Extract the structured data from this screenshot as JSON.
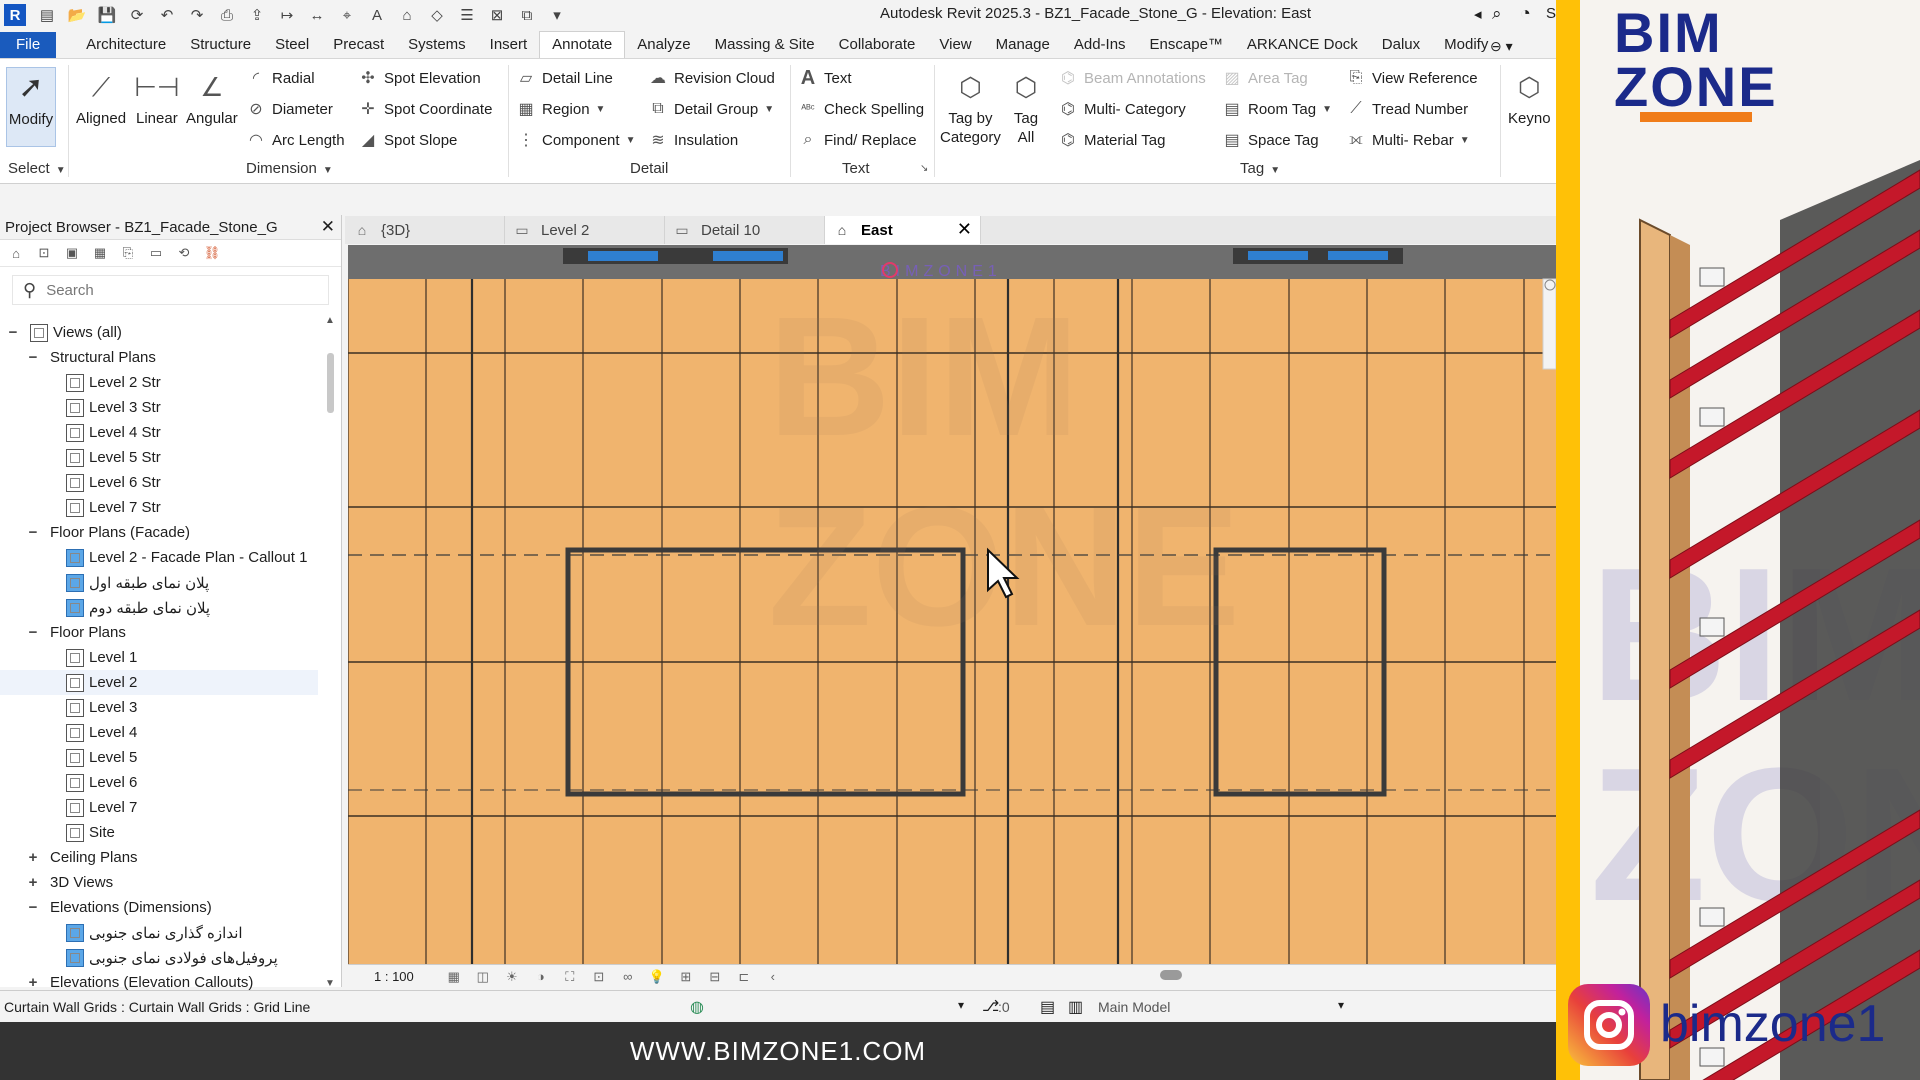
{
  "app": {
    "title": "Autodesk Revit 2025.3 - BZ1_Facade_Stone_G - Elevation: East",
    "logo_letter": "R",
    "user_initial": "S"
  },
  "menu": [
    "File",
    "Architecture",
    "Structure",
    "Steel",
    "Precast",
    "Systems",
    "Insert",
    "Annotate",
    "Analyze",
    "Massing & Site",
    "Collaborate",
    "View",
    "Manage",
    "Add-Ins",
    "Enscape™",
    "ARKANCE Dock",
    "Dalux",
    "Modify"
  ],
  "ribbon": {
    "select": {
      "modify": "Modify",
      "panel": "Select"
    },
    "dimension": {
      "aligned": "Aligned",
      "linear": "Linear",
      "angular": "Angular",
      "radial": "Radial",
      "diameter": "Diameter",
      "arc_length": "Arc  Length",
      "spot_elevation": "Spot  Elevation",
      "spot_coordinate": "Spot  Coordinate",
      "spot_slope": "Spot  Slope",
      "panel": "Dimension"
    },
    "detail": {
      "detail_line": "Detail  Line",
      "region": "Region",
      "component": "Component",
      "revision_cloud": "Revision  Cloud",
      "detail_group": "Detail  Group",
      "insulation": "Insulation",
      "panel": "Detail"
    },
    "text": {
      "text": "Text",
      "check_spelling": "Check  Spelling",
      "find_replace": "Find/  Replace",
      "panel": "Text"
    },
    "tag": {
      "tag_by_category_1": "Tag by",
      "tag_by_category_2": "Category",
      "tag_all_1": "Tag",
      "tag_all_2": "All",
      "beam_annotations": "Beam  Annotations",
      "multi_category": "Multi-  Category",
      "material_tag": "Material  Tag",
      "area_tag": "Area  Tag",
      "room_tag": "Room  Tag",
      "space_tag": "Space  Tag",
      "view_reference": "View  Reference",
      "tread_number": "Tread  Number",
      "multi_rebar": "Multi-  Rebar",
      "keynote": "Keyno",
      "panel": "Tag"
    }
  },
  "project_browser": {
    "title": "Project Browser - BZ1_Facade_Stone_G",
    "search_placeholder": "Search",
    "rows": [
      {
        "label": "Views (all)",
        "level": 0,
        "toggle": "−",
        "icon": "views"
      },
      {
        "label": "Structural Plans",
        "level": 1,
        "toggle": "−"
      },
      {
        "label": "Level 2 Str",
        "level": 2,
        "icon": "plan"
      },
      {
        "label": "Level 3 Str",
        "level": 2,
        "icon": "plan"
      },
      {
        "label": "Level 4 Str",
        "level": 2,
        "icon": "plan"
      },
      {
        "label": "Level 5 Str",
        "level": 2,
        "icon": "plan"
      },
      {
        "label": "Level 6 Str",
        "level": 2,
        "icon": "plan"
      },
      {
        "label": "Level 7 Str",
        "level": 2,
        "icon": "plan"
      },
      {
        "label": "Floor Plans (Facade)",
        "level": 1,
        "toggle": "−"
      },
      {
        "label": "Level 2 - Facade Plan - Callout 1",
        "level": 2,
        "icon": "blue"
      },
      {
        "label": "پلان نمای طبقه اول",
        "level": 2,
        "icon": "blue"
      },
      {
        "label": "پلان نمای طبقه دوم",
        "level": 2,
        "icon": "blue"
      },
      {
        "label": "Floor Plans",
        "level": 1,
        "toggle": "−"
      },
      {
        "label": "Level 1",
        "level": 2,
        "icon": "plan"
      },
      {
        "label": "Level 2",
        "level": 2,
        "icon": "plan",
        "selected": true
      },
      {
        "label": "Level 3",
        "level": 2,
        "icon": "plan"
      },
      {
        "label": "Level 4",
        "level": 2,
        "icon": "plan"
      },
      {
        "label": "Level 5",
        "level": 2,
        "icon": "plan"
      },
      {
        "label": "Level 6",
        "level": 2,
        "icon": "plan"
      },
      {
        "label": "Level 7",
        "level": 2,
        "icon": "plan"
      },
      {
        "label": "Site",
        "level": 2,
        "icon": "plan"
      },
      {
        "label": "Ceiling Plans",
        "level": 1,
        "toggle": "+"
      },
      {
        "label": "3D Views",
        "level": 1,
        "toggle": "+"
      },
      {
        "label": "Elevations (Dimensions)",
        "level": 1,
        "toggle": "−"
      },
      {
        "label": "اندازه گذاری نمای جنوبی",
        "level": 2,
        "icon": "blue"
      },
      {
        "label": "پروفیل‌های فولادی نمای جنوبی",
        "level": 2,
        "icon": "blue"
      },
      {
        "label": "Elevations (Elevation Callouts)",
        "level": 1,
        "toggle": "+"
      }
    ]
  },
  "view_tabs": [
    {
      "label": "{3D}",
      "icon": "⌂"
    },
    {
      "label": "Level 2",
      "icon": "▭"
    },
    {
      "label": "Detail 10",
      "icon": "▭"
    },
    {
      "label": "East",
      "icon": "⌂",
      "active": true
    }
  ],
  "view_bar": {
    "scale": "1 : 100"
  },
  "status": {
    "text": "Curtain Wall Grids : Curtain Wall Grids : Grid Line",
    "count": ":0",
    "model": "Main Model"
  },
  "canvas": {
    "watermark": "BIMZONE1",
    "bg_watermark_1": "BIM",
    "bg_watermark_2": "ZONE"
  },
  "footer": {
    "url": "WWW.BIMZONE1.COM"
  },
  "promo": {
    "brand_line1": "BIM",
    "brand_line2": "ZONE",
    "instagram": "bimzone1",
    "accent": "#f07c19",
    "brand_color": "#1b2a8a"
  }
}
